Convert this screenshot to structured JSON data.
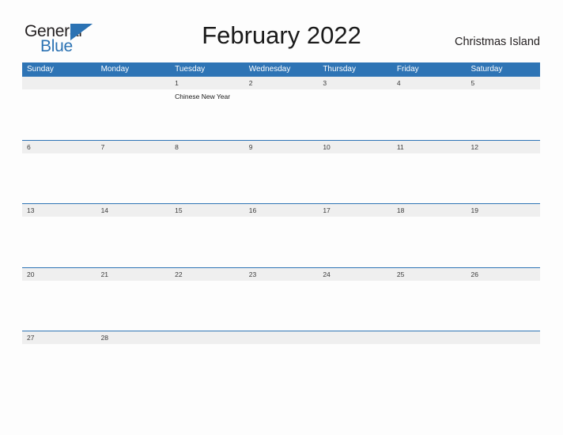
{
  "brand": {
    "name_part1": "General",
    "name_part2": "Blue",
    "accent_color": "#2b72b3",
    "triangle_icon": "triangle-icon"
  },
  "header": {
    "title": "February 2022",
    "region": "Christmas Island"
  },
  "calendar": {
    "month": "February",
    "year": "2022",
    "header_color": "#2e74b5",
    "date_band_color": "#efefef",
    "weekdays": [
      "Sunday",
      "Monday",
      "Tuesday",
      "Wednesday",
      "Thursday",
      "Friday",
      "Saturday"
    ],
    "weeks": [
      {
        "days": [
          {
            "date": "",
            "event": ""
          },
          {
            "date": "",
            "event": ""
          },
          {
            "date": "1",
            "event": "Chinese New Year"
          },
          {
            "date": "2",
            "event": ""
          },
          {
            "date": "3",
            "event": ""
          },
          {
            "date": "4",
            "event": ""
          },
          {
            "date": "5",
            "event": ""
          }
        ]
      },
      {
        "days": [
          {
            "date": "6",
            "event": ""
          },
          {
            "date": "7",
            "event": ""
          },
          {
            "date": "8",
            "event": ""
          },
          {
            "date": "9",
            "event": ""
          },
          {
            "date": "10",
            "event": ""
          },
          {
            "date": "11",
            "event": ""
          },
          {
            "date": "12",
            "event": ""
          }
        ]
      },
      {
        "days": [
          {
            "date": "13",
            "event": ""
          },
          {
            "date": "14",
            "event": ""
          },
          {
            "date": "15",
            "event": ""
          },
          {
            "date": "16",
            "event": ""
          },
          {
            "date": "17",
            "event": ""
          },
          {
            "date": "18",
            "event": ""
          },
          {
            "date": "19",
            "event": ""
          }
        ]
      },
      {
        "days": [
          {
            "date": "20",
            "event": ""
          },
          {
            "date": "21",
            "event": ""
          },
          {
            "date": "22",
            "event": ""
          },
          {
            "date": "23",
            "event": ""
          },
          {
            "date": "24",
            "event": ""
          },
          {
            "date": "25",
            "event": ""
          },
          {
            "date": "26",
            "event": ""
          }
        ]
      },
      {
        "days": [
          {
            "date": "27",
            "event": ""
          },
          {
            "date": "28",
            "event": ""
          },
          {
            "date": "",
            "event": ""
          },
          {
            "date": "",
            "event": ""
          },
          {
            "date": "",
            "event": ""
          },
          {
            "date": "",
            "event": ""
          },
          {
            "date": "",
            "event": ""
          }
        ]
      }
    ]
  }
}
